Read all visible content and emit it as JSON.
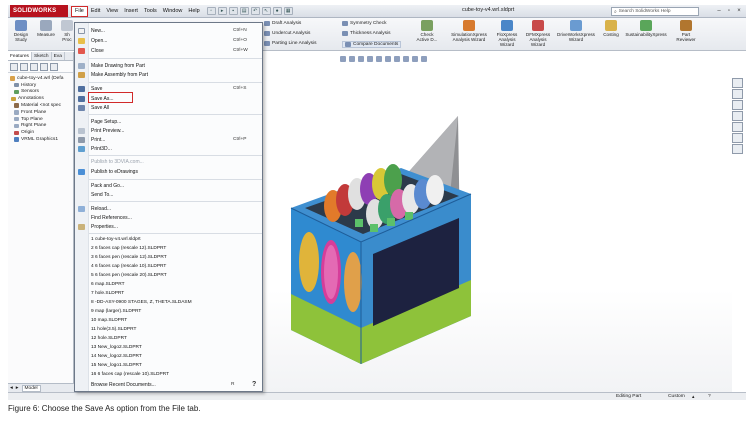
{
  "app": {
    "logo_text": "SOLIDWORKS",
    "document_title": "cube-toy-v4.wrl.sldprt",
    "search_placeholder": "Search SolidWorks Help"
  },
  "menubar": [
    "File",
    "Edit",
    "View",
    "Insert",
    "Tools",
    "Window",
    "Help"
  ],
  "command_manager": {
    "left_buttons": [
      {
        "label": "Design Study"
      },
      {
        "label": "Measure"
      },
      {
        "label": "Sh Proc"
      }
    ],
    "right_rows": [
      {
        "label": "Draft Analysis"
      },
      {
        "label": "Undercut Analysis"
      },
      {
        "label": "Parting Line Analysis"
      },
      {
        "label": "Symmetry Check"
      },
      {
        "label": "Thickness Analysis"
      },
      {
        "label": "Compare Documents"
      }
    ],
    "check_active_label": "Check Active D...",
    "wizards": [
      {
        "label": "SimulationXpress Analysis Wizard"
      },
      {
        "label": "FloXpress Analysis Wizard"
      },
      {
        "label": "DFMXpress Analysis Wizard"
      },
      {
        "label": "DriveWorksXpress Wizard"
      },
      {
        "label": "Costing"
      },
      {
        "label": "SustainabilityXpress"
      },
      {
        "label": "Part Reviewer"
      }
    ]
  },
  "left_panel": {
    "tabs": [
      "Features",
      "Sketch",
      "Eva"
    ],
    "tree": [
      "cube-toy-v4.wrl (Defa",
      "History",
      "Sensors",
      "Annotations",
      "Material <not spec",
      "Front Plane",
      "Top Plane",
      "Right Plane",
      "Origin",
      "VRML Graphics1"
    ],
    "bottom_tab": "Model"
  },
  "file_menu": {
    "items": [
      {
        "label": "New...",
        "shortcut": "Ctrl+N",
        "icon": "new-doc-icon"
      },
      {
        "label": "Open...",
        "shortcut": "Ctrl+O",
        "icon": "open-folder-icon"
      },
      {
        "label": "Close",
        "shortcut": "Ctrl+W",
        "icon": ""
      },
      {
        "label": "Make Drawing from Part",
        "shortcut": "",
        "icon": "drawing-icon"
      },
      {
        "label": "Make Assembly from Part",
        "shortcut": "",
        "icon": "assembly-icon"
      },
      {
        "label": "Save",
        "shortcut": "Ctrl+S",
        "icon": "save-icon"
      },
      {
        "label": "Save As...",
        "shortcut": "",
        "icon": "save-as-icon"
      },
      {
        "label": "Save All",
        "shortcut": "",
        "icon": "save-all-icon"
      },
      {
        "label": "Page Setup...",
        "shortcut": "",
        "icon": ""
      },
      {
        "label": "Print Preview...",
        "shortcut": "",
        "icon": "print-preview-icon"
      },
      {
        "label": "Print...",
        "shortcut": "Ctrl+P",
        "icon": "print-icon"
      },
      {
        "label": "Print3D...",
        "shortcut": "",
        "icon": "print3d-icon"
      },
      {
        "label": "Publish to 3DVIA.com...",
        "shortcut": "",
        "icon": ""
      },
      {
        "label": "Publish to eDrawings",
        "shortcut": "",
        "icon": "edrawings-icon"
      },
      {
        "label": "Pack and Go...",
        "shortcut": "",
        "icon": ""
      },
      {
        "label": "Send To...",
        "shortcut": "",
        "icon": ""
      },
      {
        "label": "Reload...",
        "shortcut": "",
        "icon": "reload-icon"
      },
      {
        "label": "Find References...",
        "shortcut": "",
        "icon": ""
      },
      {
        "label": "Properties...",
        "shortcut": "",
        "icon": "properties-icon"
      }
    ],
    "recent": [
      "1 cube-toy-v4.wrl.sldprt",
      "2 6 faces cap (rescale 12).SLDPRT",
      "3 6 faces pen (rescale 12).SLDPRT",
      "4 6 faces cap (rescale 10).SLDPRT",
      "5 6 faces pen (rescale 20).SLDPRT",
      "6 map.SLDPRT",
      "7 hole.SLDPRT",
      "8 -DD-ASY-0900 STAGES, Z, THETA.SLDASM",
      "9 map (larger).SLDPRT",
      "10 map.SLDPRT",
      "11 hole(3.5).SLDPRT",
      "12 hole.SLDPRT",
      "13 New_logo2.SLDPRT",
      "14 New_logo2.SLDPRT",
      "15 New_logo1.SLDPRT",
      "16 6 faces cap (rescale 10).SLDPRT"
    ],
    "browse_recent": "Browse Recent Documents...",
    "browse_shortcut": "R",
    "help_glyph": "?"
  },
  "status_bar": {
    "mode": "Editing Part",
    "units": "Custom"
  },
  "caption": "Figure 6: Choose the Save As option from the File tab.",
  "colors": {
    "highlight": "#d12a2a",
    "logo": "#b7121e"
  }
}
